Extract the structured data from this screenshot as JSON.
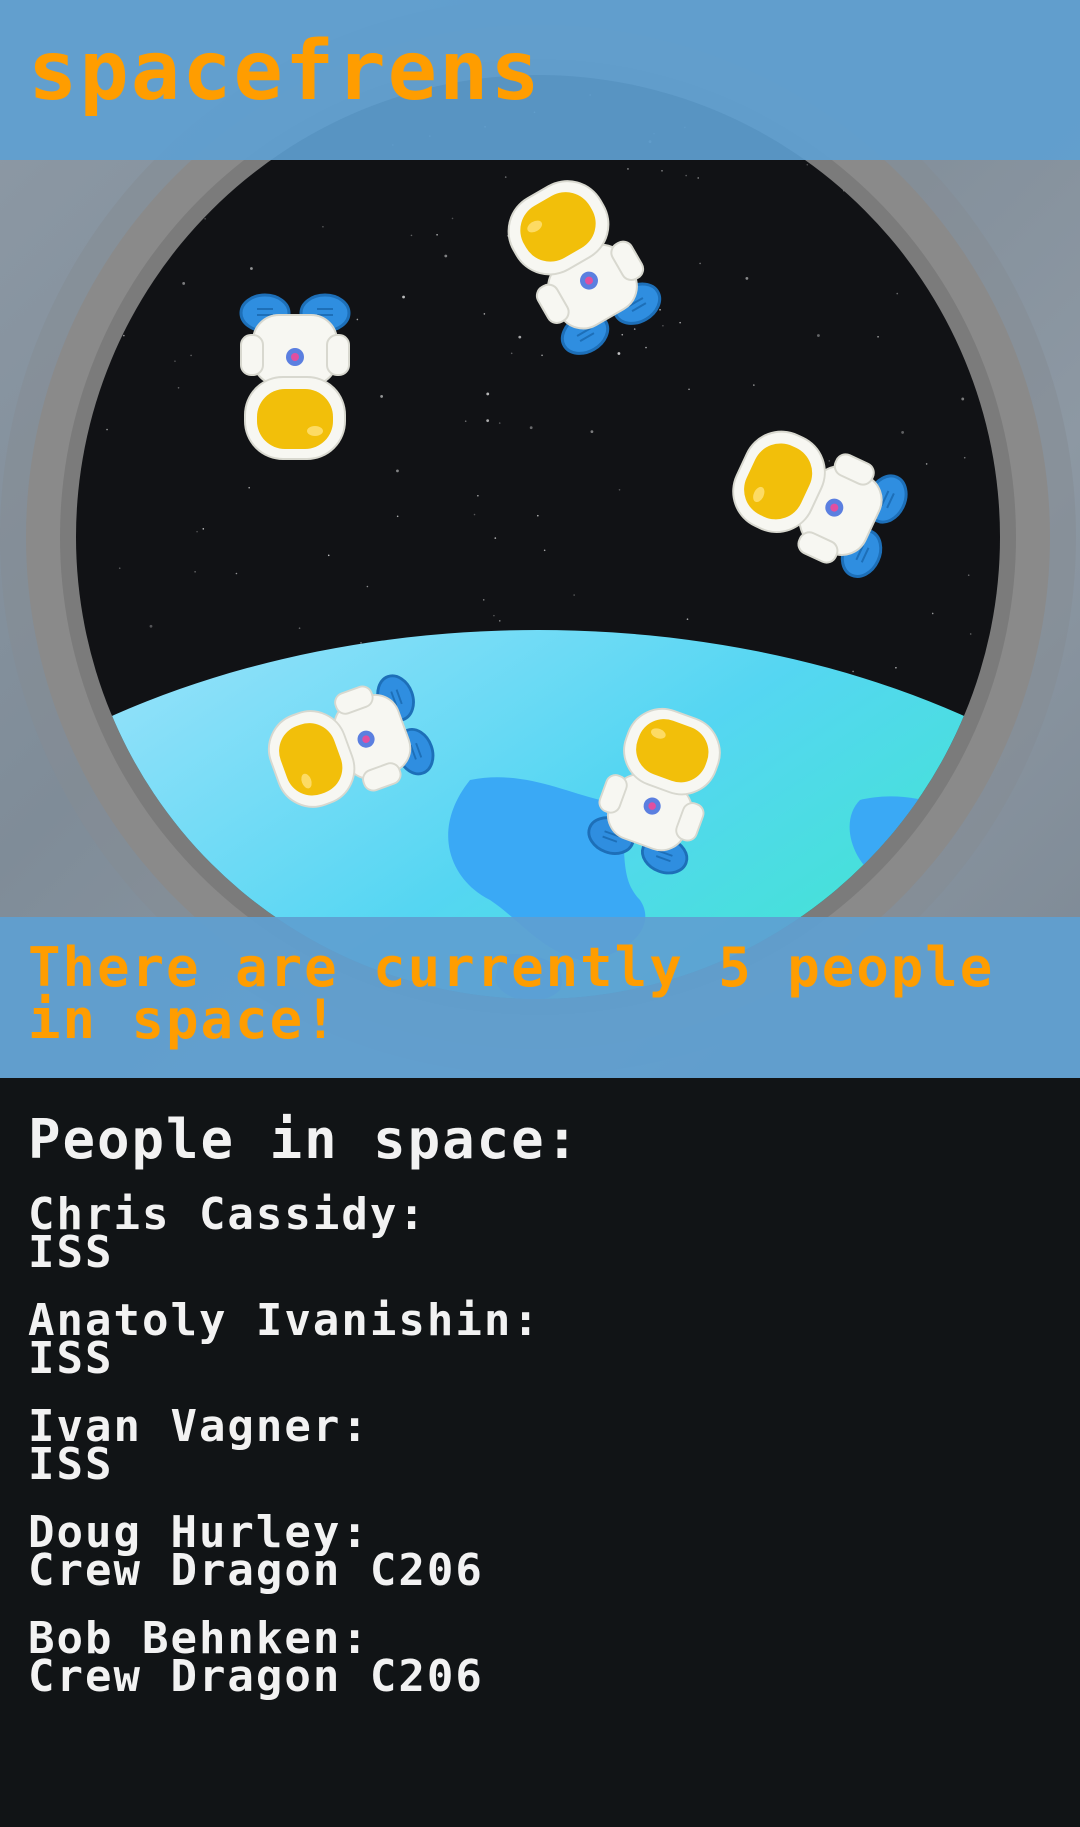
{
  "app": {
    "title": "spacefrens"
  },
  "banner": {
    "text": "There are currently 5 people in space!"
  },
  "people_section": {
    "heading": "People in space:",
    "people": [
      {
        "name": "Chris Cassidy:",
        "craft": "ISS"
      },
      {
        "name": "Anatoly Ivanishin:",
        "craft": "ISS"
      },
      {
        "name": "Ivan Vagner:",
        "craft": "ISS"
      },
      {
        "name": "Doug Hurley:",
        "craft": "Crew Dragon C206"
      },
      {
        "name": "Bob Behnken:",
        "craft": "Crew Dragon C206"
      }
    ]
  },
  "colors": {
    "accent": "#ff9d00",
    "bar": "#5ea0d1",
    "background": "#111416",
    "space": "#0e0f14",
    "earth_ocean": "#3fb6ff",
    "earth_land": "#38f0b8",
    "visor": "#f2bf0a",
    "boot": "#2f8ee0"
  },
  "illustration": {
    "astronaut_count": 5,
    "astronaut_icon": "astronaut-icon",
    "planet_icon": "earth-icon",
    "window_icon": "porthole-window"
  }
}
